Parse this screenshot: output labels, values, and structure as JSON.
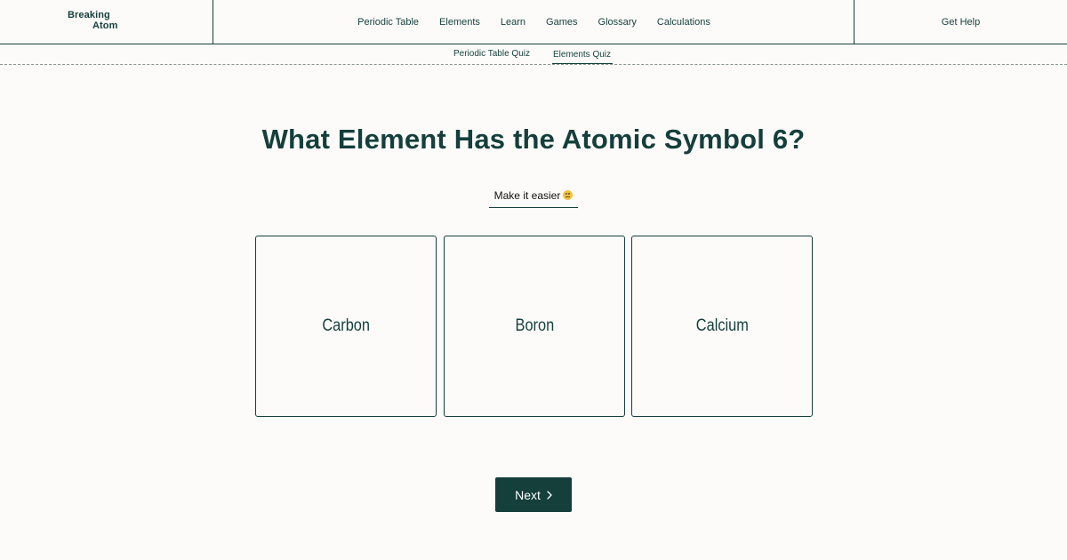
{
  "logo": {
    "line1": "Breaking",
    "line2": "Atom"
  },
  "nav": {
    "items": [
      "Periodic Table",
      "Elements",
      "Learn",
      "Games",
      "Glossary",
      "Calculations"
    ],
    "help": "Get Help"
  },
  "subnav": {
    "items": [
      "Periodic Table Quiz",
      "Elements Quiz"
    ],
    "active": "Elements Quiz"
  },
  "quiz": {
    "question": "What Element Has the Atomic Symbol 6?",
    "hint": "Make it easier",
    "hint_icon": "grimace-emoji-icon",
    "options": [
      "Carbon",
      "Boron",
      "Calcium"
    ],
    "next_label": "Next",
    "next_icon": "chevron-right-icon"
  },
  "colors": {
    "brand": "#143f3b",
    "background": "#fcfbf9",
    "hint_emoji": "#f2c23c"
  }
}
